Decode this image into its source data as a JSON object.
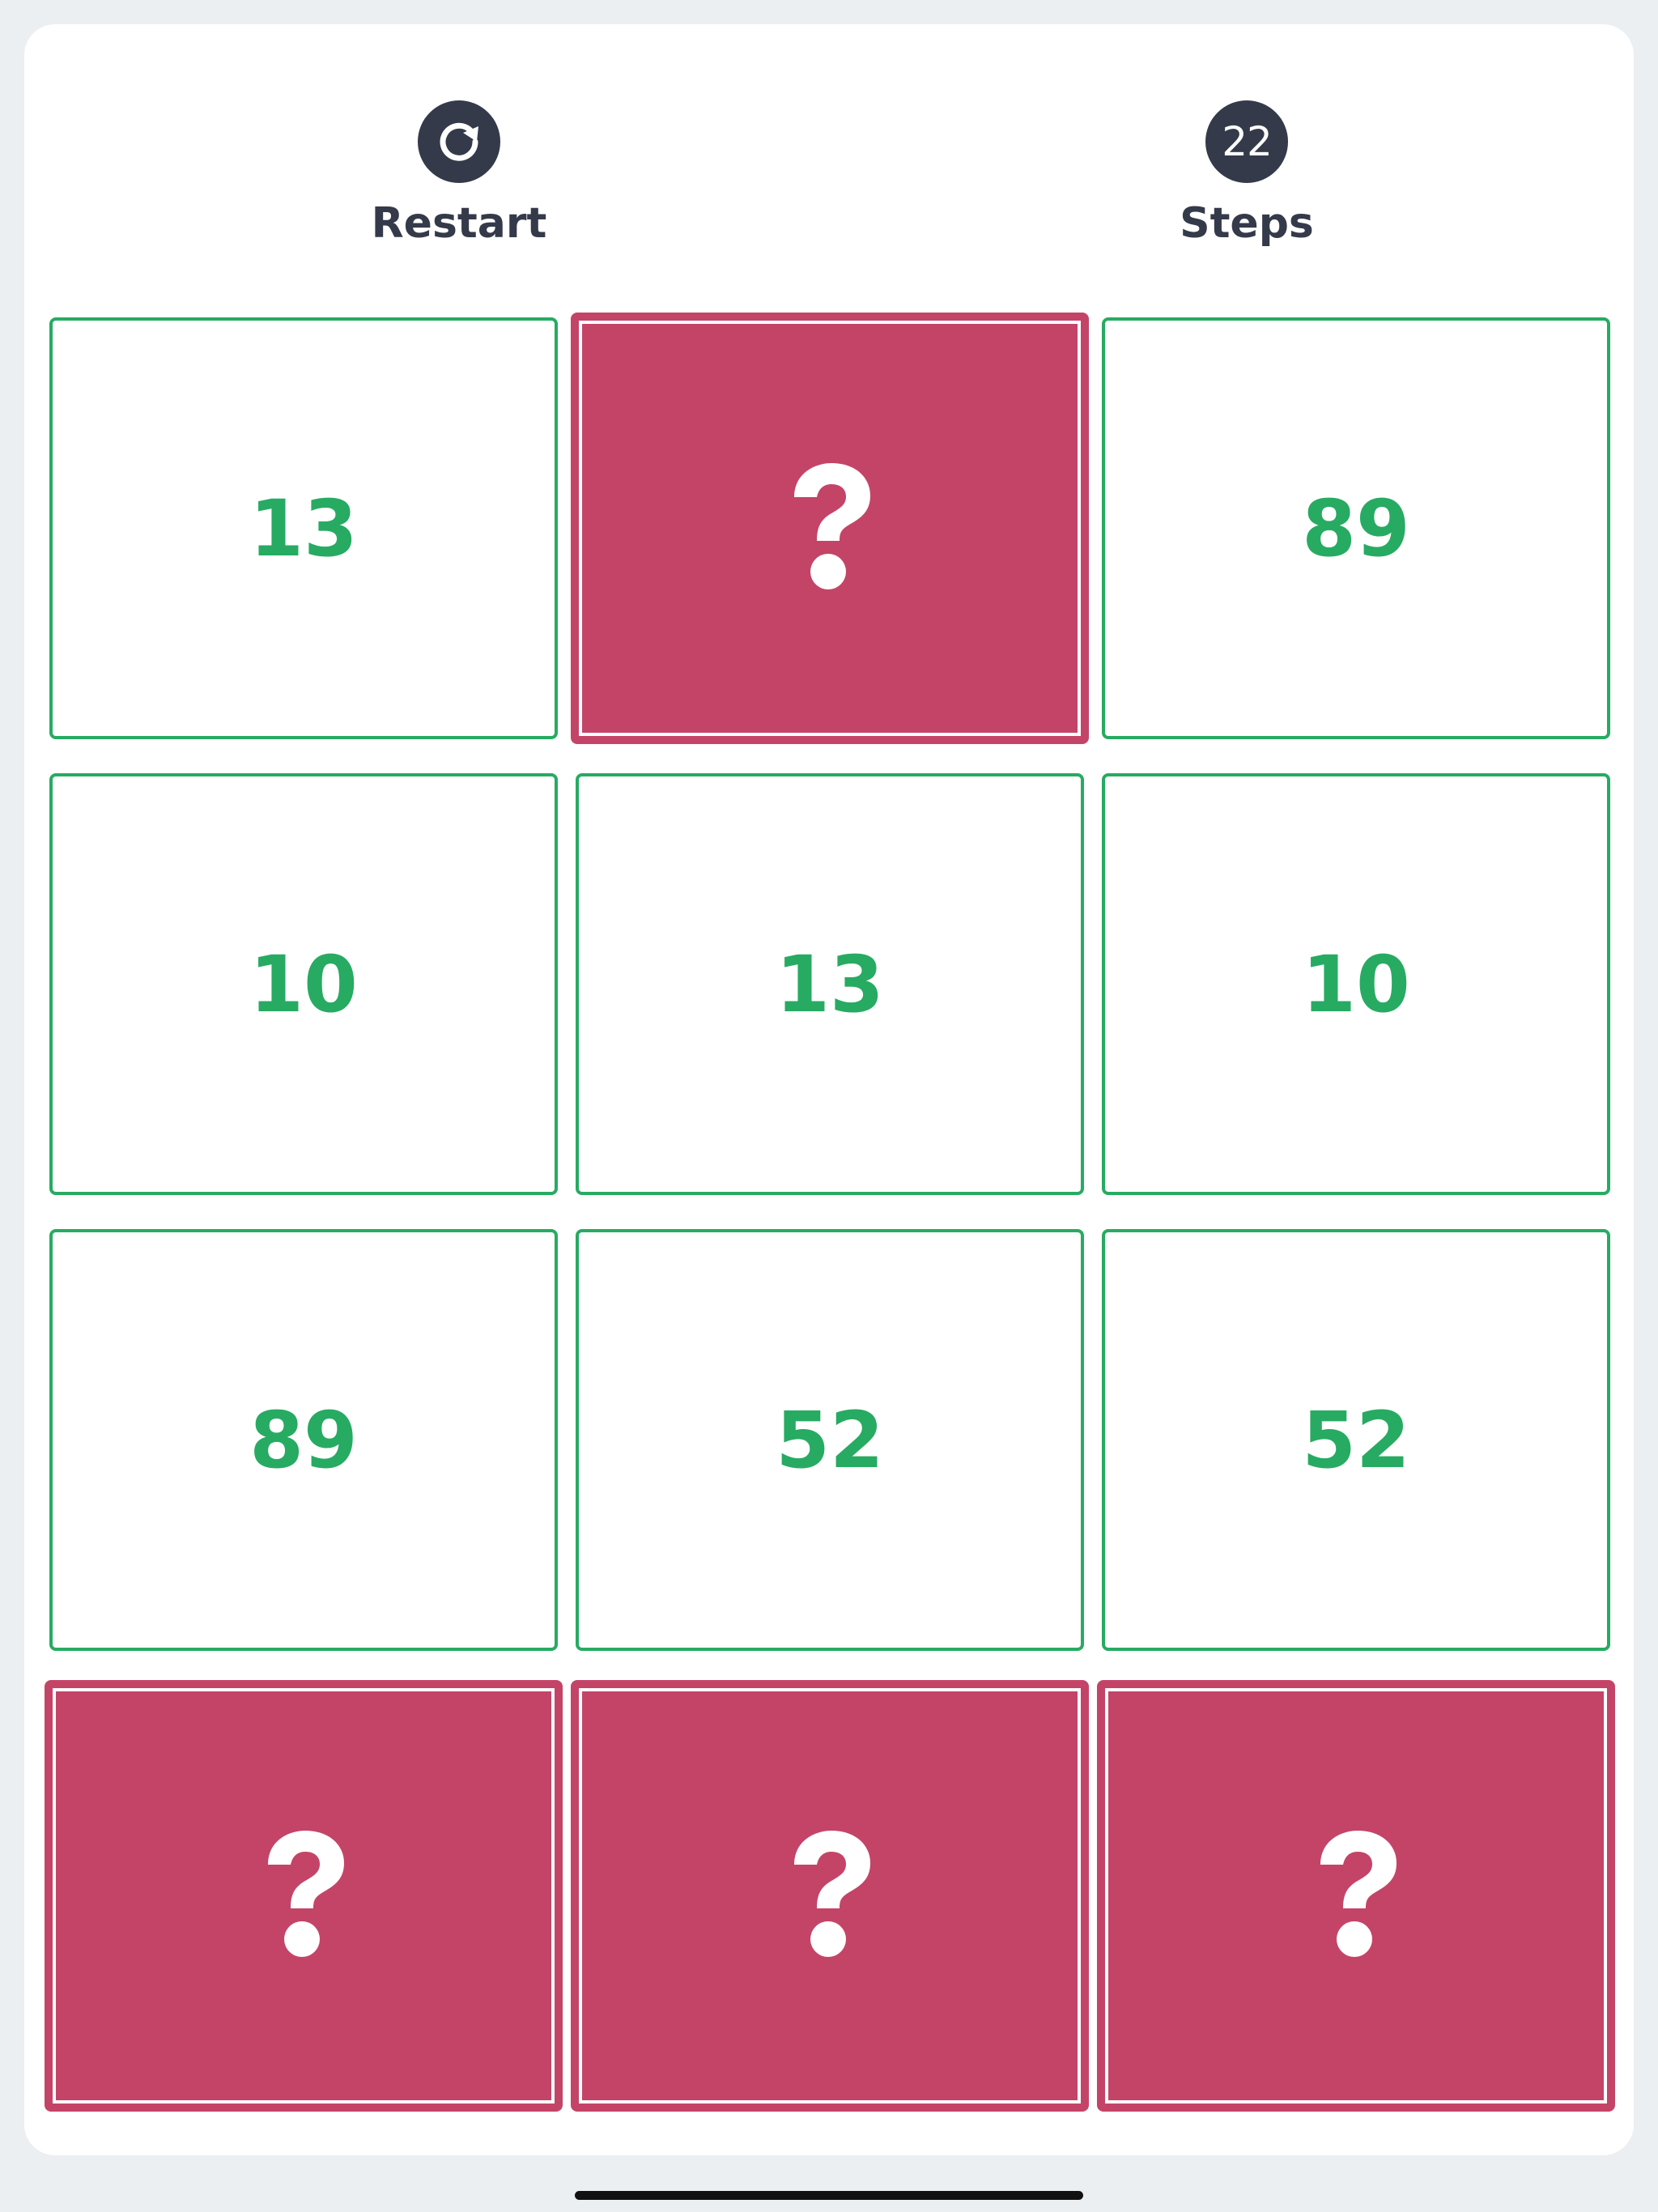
{
  "header": {
    "restart": {
      "label": "Restart",
      "icon": "restart-icon"
    },
    "steps": {
      "count": "22",
      "label": "Steps"
    }
  },
  "colors": {
    "matched": "#27ab62",
    "hidden": "#c44468",
    "dark": "#343a4a",
    "background": "#ebeff1"
  },
  "board": {
    "columns": 3,
    "rows": 4,
    "tiles": [
      {
        "state": "open",
        "value": "13"
      },
      {
        "state": "hidden",
        "value": "?"
      },
      {
        "state": "open",
        "value": "89"
      },
      {
        "state": "open",
        "value": "10"
      },
      {
        "state": "open",
        "value": "13"
      },
      {
        "state": "open",
        "value": "10"
      },
      {
        "state": "open",
        "value": "89"
      },
      {
        "state": "open",
        "value": "52"
      },
      {
        "state": "open",
        "value": "52"
      },
      {
        "state": "hidden",
        "value": "?"
      },
      {
        "state": "hidden",
        "value": "?"
      },
      {
        "state": "hidden",
        "value": "?"
      }
    ]
  }
}
